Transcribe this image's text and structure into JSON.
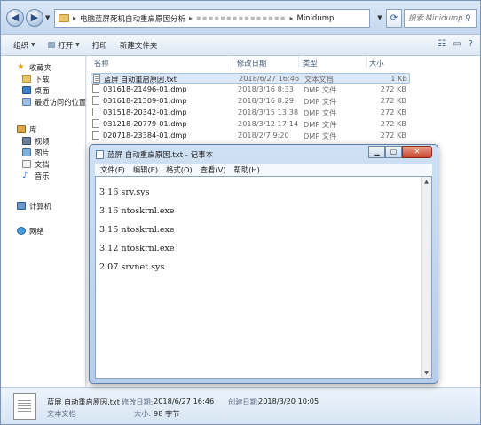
{
  "address": {
    "crumbs": [
      "电脑蓝屏死机自动重启原因分析",
      "▪▪▪▪▪▪▪▪▪▪▪▪▪▪▪",
      "Minidump"
    ],
    "search_placeholder": "搜索 Minidump"
  },
  "toolbar": {
    "organize": "组织",
    "open": "打开",
    "print": "打印",
    "new_folder": "新建文件夹"
  },
  "navpane": {
    "favorites": "收藏夹",
    "downloads": "下载",
    "desktop": "桌面",
    "recent": "最近访问的位置",
    "libraries": "库",
    "videos": "视频",
    "pictures": "图片",
    "documents": "文档",
    "music": "音乐",
    "computer": "计算机",
    "network": "网络"
  },
  "filelist": {
    "columns": {
      "name": "名称",
      "date": "修改日期",
      "type": "类型",
      "size": "大小"
    },
    "rows": [
      {
        "name": "蓝屏 自动重启原因.txt",
        "date": "2018/6/27 16:46",
        "type": "文本文档",
        "size": "1 KB"
      },
      {
        "name": "031618-21496-01.dmp",
        "date": "2018/3/16 8:33",
        "type": "DMP 文件",
        "size": "272 KB"
      },
      {
        "name": "031618-21309-01.dmp",
        "date": "2018/3/16 8:29",
        "type": "DMP 文件",
        "size": "272 KB"
      },
      {
        "name": "031518-20342-01.dmp",
        "date": "2018/3/15 13:38",
        "type": "DMP 文件",
        "size": "272 KB"
      },
      {
        "name": "031218-20779-01.dmp",
        "date": "2018/3/12 17:14",
        "type": "DMP 文件",
        "size": "272 KB"
      },
      {
        "name": "020718-23384-01.dmp",
        "date": "2018/2/7 9:20",
        "type": "DMP 文件",
        "size": "272 KB"
      }
    ]
  },
  "details": {
    "filename": "蓝屏 自动重启原因.txt",
    "modified_label": "修改日期:",
    "modified_value": "2018/6/27 16:46",
    "created_label": "创建日期:",
    "created_value": "2018/3/20 10:05",
    "filetype": "文本文档",
    "size_label": "大小:",
    "size_value": "98 字节"
  },
  "notepad": {
    "title": "蓝屏 自动重启原因.txt - 记事本",
    "menu": [
      "文件(F)",
      "编辑(E)",
      "格式(O)",
      "查看(V)",
      "帮助(H)"
    ],
    "lines": [
      "3.16 srv.sys",
      "3.16 ntoskrnl.exe",
      "3.15 ntoskrnl.exe",
      "3.12 ntoskrnl.exe",
      "2.07 srvnet.sys"
    ]
  }
}
